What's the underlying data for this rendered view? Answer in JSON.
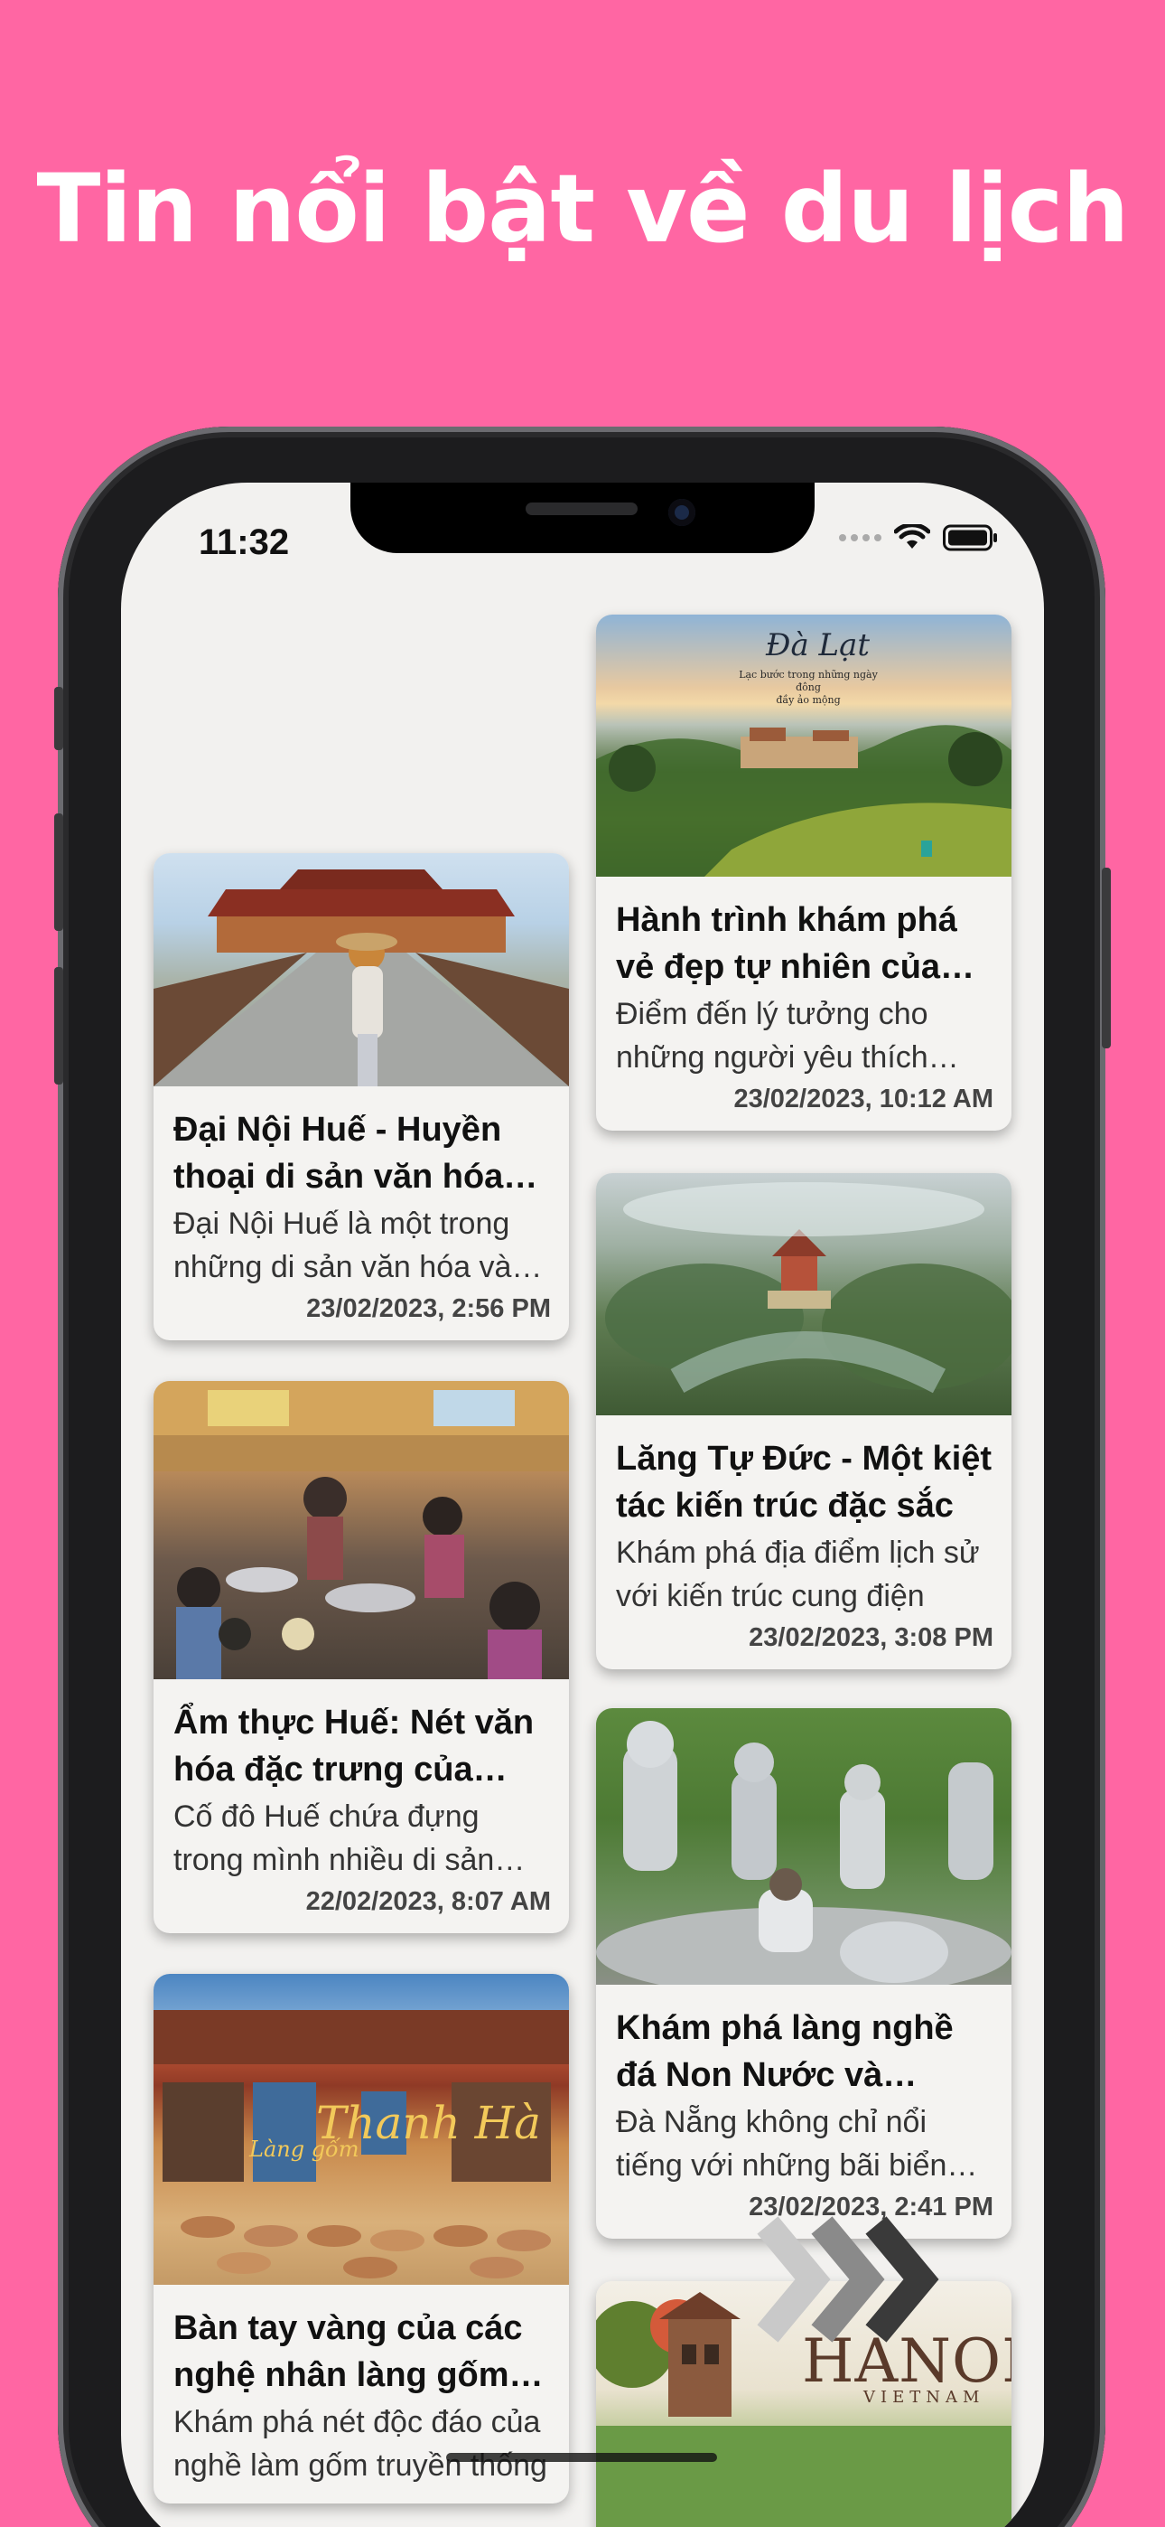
{
  "promo": {
    "headline": "Tin nổi bật về du lịch"
  },
  "status_bar": {
    "time": "11:32",
    "icons": [
      "signal-dots-icon",
      "wifi-icon",
      "battery-icon"
    ]
  },
  "colors": {
    "background": "#ff66a3",
    "screen": "#f2f1ef",
    "card": "#f4f3f1"
  },
  "articles": [
    {
      "column": "right",
      "image": "dalat-landscape",
      "image_title": "Đà Lạt",
      "image_subtitle": "Lạc bước trong những ngày đông\nđầy ảo mộng",
      "title": "Hành trình khám phá vẻ đẹp tự nhiên của Đà Lạt",
      "description": " Điểm đến lý tưởng cho những người yêu thích thiên nhiên",
      "date": "23/02/2023, 10:12 AM"
    },
    {
      "column": "left",
      "image": "hue-imperial-city",
      "title": "Đại Nội Huế - Huyền thoại di sản văn hóa Việt Nam",
      "description": "Đại Nội Huế là một trong những di sản văn hóa và lịch sử",
      "date": "23/02/2023, 2:56 PM"
    },
    {
      "column": "right",
      "image": "tu-duc-tomb",
      "title": "Lăng Tự Đức - Một kiệt tác kiến trúc đặc sắc",
      "description": "Khám phá địa điểm lịch sử với kiến trúc cung điện",
      "date": "23/02/2023, 3:08 PM"
    },
    {
      "column": "left",
      "image": "hue-cuisine-market",
      "title": "Ẩm thực Huế: Nét văn hóa đặc trưng của vùng đất cố đô",
      "description": "Cố đô Huế chứa đựng trong mình nhiều di sản văn hóa",
      "date": "22/02/2023, 8:07 AM"
    },
    {
      "column": "right",
      "image": "non-nuoc-stone-statues",
      "title": "Khám phá làng nghề đá Non Nước và những tác phẩm",
      "description": "Đà Nẵng không chỉ nổi tiếng với những bãi biển đẹp",
      "date": "23/02/2023, 2:41 PM"
    },
    {
      "column": "left",
      "image": "thanh-ha-pottery",
      "image_title": "Thanh Hà",
      "image_subtitle": "Làng gốm",
      "title": "Bàn tay vàng của các nghệ nhân làng gốm Thanh Hà",
      "description": "Khám phá nét độc đáo của nghề làm gốm truyền thống",
      "date": ""
    },
    {
      "column": "right",
      "image": "hanoi-turtle-tower",
      "image_title": "HANOI",
      "image_subtitle": "VIETNAM",
      "title": "",
      "description": "",
      "date": ""
    }
  ]
}
